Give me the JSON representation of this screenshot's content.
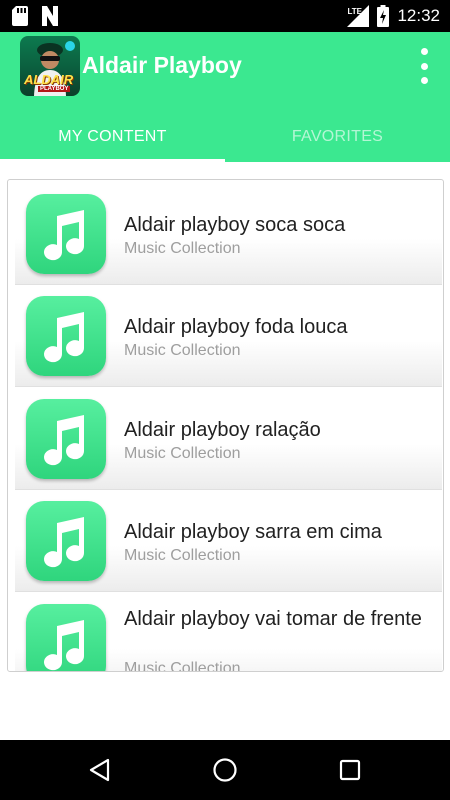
{
  "status_bar": {
    "time": "12:32",
    "network_label": "LTE",
    "icons": [
      "sd-card-icon",
      "notification-n-icon",
      "lte-signal-icon",
      "battery-charging-icon"
    ]
  },
  "app_bar": {
    "title": "Aldair Playboy",
    "logo_text": "ALDAIR",
    "logo_subtext": "PLAYBOY",
    "menu_icon": "overflow-menu-icon"
  },
  "tabs": [
    {
      "label": "MY CONTENT",
      "active": true
    },
    {
      "label": "FAVORITES",
      "active": false
    }
  ],
  "items": [
    {
      "title": "Aldair playboy soca soca",
      "subtitle": "Music Collection",
      "icon": "music-note-icon"
    },
    {
      "title": "Aldair playboy foda louca",
      "subtitle": "Music Collection",
      "icon": "music-note-icon"
    },
    {
      "title": "Aldair playboy ralação",
      "subtitle": "Music Collection",
      "icon": "music-note-icon"
    },
    {
      "title": "Aldair playboy sarra em cima",
      "subtitle": "Music Collection",
      "icon": "music-note-icon"
    },
    {
      "title": "Aldair playboy vai tomar de frente",
      "subtitle": "Music Collection",
      "icon": "music-note-icon"
    }
  ],
  "nav_bar": {
    "icons": [
      "back-icon",
      "home-icon",
      "recents-icon"
    ]
  },
  "colors": {
    "primary": "#3be890",
    "icon_green": "#3fdf89",
    "status_bar": "#000000"
  }
}
